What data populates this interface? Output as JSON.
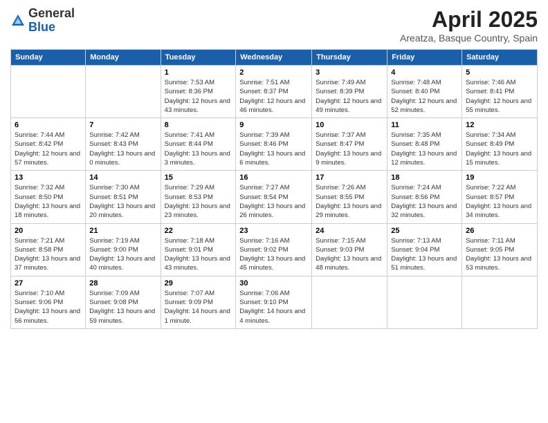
{
  "logo": {
    "general": "General",
    "blue": "Blue"
  },
  "title": "April 2025",
  "location": "Areatza, Basque Country, Spain",
  "weekdays": [
    "Sunday",
    "Monday",
    "Tuesday",
    "Wednesday",
    "Thursday",
    "Friday",
    "Saturday"
  ],
  "weeks": [
    [
      {
        "day": "",
        "sunrise": "",
        "sunset": "",
        "daylight": ""
      },
      {
        "day": "",
        "sunrise": "",
        "sunset": "",
        "daylight": ""
      },
      {
        "day": "1",
        "sunrise": "Sunrise: 7:53 AM",
        "sunset": "Sunset: 8:36 PM",
        "daylight": "Daylight: 12 hours and 43 minutes."
      },
      {
        "day": "2",
        "sunrise": "Sunrise: 7:51 AM",
        "sunset": "Sunset: 8:37 PM",
        "daylight": "Daylight: 12 hours and 46 minutes."
      },
      {
        "day": "3",
        "sunrise": "Sunrise: 7:49 AM",
        "sunset": "Sunset: 8:39 PM",
        "daylight": "Daylight: 12 hours and 49 minutes."
      },
      {
        "day": "4",
        "sunrise": "Sunrise: 7:48 AM",
        "sunset": "Sunset: 8:40 PM",
        "daylight": "Daylight: 12 hours and 52 minutes."
      },
      {
        "day": "5",
        "sunrise": "Sunrise: 7:46 AM",
        "sunset": "Sunset: 8:41 PM",
        "daylight": "Daylight: 12 hours and 55 minutes."
      }
    ],
    [
      {
        "day": "6",
        "sunrise": "Sunrise: 7:44 AM",
        "sunset": "Sunset: 8:42 PM",
        "daylight": "Daylight: 12 hours and 57 minutes."
      },
      {
        "day": "7",
        "sunrise": "Sunrise: 7:42 AM",
        "sunset": "Sunset: 8:43 PM",
        "daylight": "Daylight: 13 hours and 0 minutes."
      },
      {
        "day": "8",
        "sunrise": "Sunrise: 7:41 AM",
        "sunset": "Sunset: 8:44 PM",
        "daylight": "Daylight: 13 hours and 3 minutes."
      },
      {
        "day": "9",
        "sunrise": "Sunrise: 7:39 AM",
        "sunset": "Sunset: 8:46 PM",
        "daylight": "Daylight: 13 hours and 6 minutes."
      },
      {
        "day": "10",
        "sunrise": "Sunrise: 7:37 AM",
        "sunset": "Sunset: 8:47 PM",
        "daylight": "Daylight: 13 hours and 9 minutes."
      },
      {
        "day": "11",
        "sunrise": "Sunrise: 7:35 AM",
        "sunset": "Sunset: 8:48 PM",
        "daylight": "Daylight: 13 hours and 12 minutes."
      },
      {
        "day": "12",
        "sunrise": "Sunrise: 7:34 AM",
        "sunset": "Sunset: 8:49 PM",
        "daylight": "Daylight: 13 hours and 15 minutes."
      }
    ],
    [
      {
        "day": "13",
        "sunrise": "Sunrise: 7:32 AM",
        "sunset": "Sunset: 8:50 PM",
        "daylight": "Daylight: 13 hours and 18 minutes."
      },
      {
        "day": "14",
        "sunrise": "Sunrise: 7:30 AM",
        "sunset": "Sunset: 8:51 PM",
        "daylight": "Daylight: 13 hours and 20 minutes."
      },
      {
        "day": "15",
        "sunrise": "Sunrise: 7:29 AM",
        "sunset": "Sunset: 8:53 PM",
        "daylight": "Daylight: 13 hours and 23 minutes."
      },
      {
        "day": "16",
        "sunrise": "Sunrise: 7:27 AM",
        "sunset": "Sunset: 8:54 PM",
        "daylight": "Daylight: 13 hours and 26 minutes."
      },
      {
        "day": "17",
        "sunrise": "Sunrise: 7:26 AM",
        "sunset": "Sunset: 8:55 PM",
        "daylight": "Daylight: 13 hours and 29 minutes."
      },
      {
        "day": "18",
        "sunrise": "Sunrise: 7:24 AM",
        "sunset": "Sunset: 8:56 PM",
        "daylight": "Daylight: 13 hours and 32 minutes."
      },
      {
        "day": "19",
        "sunrise": "Sunrise: 7:22 AM",
        "sunset": "Sunset: 8:57 PM",
        "daylight": "Daylight: 13 hours and 34 minutes."
      }
    ],
    [
      {
        "day": "20",
        "sunrise": "Sunrise: 7:21 AM",
        "sunset": "Sunset: 8:58 PM",
        "daylight": "Daylight: 13 hours and 37 minutes."
      },
      {
        "day": "21",
        "sunrise": "Sunrise: 7:19 AM",
        "sunset": "Sunset: 9:00 PM",
        "daylight": "Daylight: 13 hours and 40 minutes."
      },
      {
        "day": "22",
        "sunrise": "Sunrise: 7:18 AM",
        "sunset": "Sunset: 9:01 PM",
        "daylight": "Daylight: 13 hours and 43 minutes."
      },
      {
        "day": "23",
        "sunrise": "Sunrise: 7:16 AM",
        "sunset": "Sunset: 9:02 PM",
        "daylight": "Daylight: 13 hours and 45 minutes."
      },
      {
        "day": "24",
        "sunrise": "Sunrise: 7:15 AM",
        "sunset": "Sunset: 9:03 PM",
        "daylight": "Daylight: 13 hours and 48 minutes."
      },
      {
        "day": "25",
        "sunrise": "Sunrise: 7:13 AM",
        "sunset": "Sunset: 9:04 PM",
        "daylight": "Daylight: 13 hours and 51 minutes."
      },
      {
        "day": "26",
        "sunrise": "Sunrise: 7:11 AM",
        "sunset": "Sunset: 9:05 PM",
        "daylight": "Daylight: 13 hours and 53 minutes."
      }
    ],
    [
      {
        "day": "27",
        "sunrise": "Sunrise: 7:10 AM",
        "sunset": "Sunset: 9:06 PM",
        "daylight": "Daylight: 13 hours and 56 minutes."
      },
      {
        "day": "28",
        "sunrise": "Sunrise: 7:09 AM",
        "sunset": "Sunset: 9:08 PM",
        "daylight": "Daylight: 13 hours and 59 minutes."
      },
      {
        "day": "29",
        "sunrise": "Sunrise: 7:07 AM",
        "sunset": "Sunset: 9:09 PM",
        "daylight": "Daylight: 14 hours and 1 minute."
      },
      {
        "day": "30",
        "sunrise": "Sunrise: 7:06 AM",
        "sunset": "Sunset: 9:10 PM",
        "daylight": "Daylight: 14 hours and 4 minutes."
      },
      {
        "day": "",
        "sunrise": "",
        "sunset": "",
        "daylight": ""
      },
      {
        "day": "",
        "sunrise": "",
        "sunset": "",
        "daylight": ""
      },
      {
        "day": "",
        "sunrise": "",
        "sunset": "",
        "daylight": ""
      }
    ]
  ]
}
